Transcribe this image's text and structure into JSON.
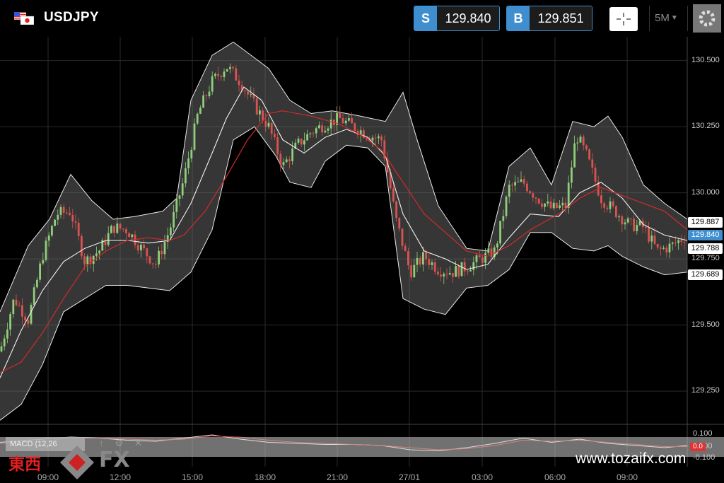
{
  "header": {
    "symbol": "USDJPY",
    "flag_icon": "us-jp-flag-icon",
    "sell": {
      "label": "S",
      "price": "129.840"
    },
    "buy": {
      "label": "B",
      "price": "129.851"
    },
    "crosshair_icon": "crosshair-icon",
    "interval": "5M",
    "settings_icon": "gear-icon"
  },
  "chart_data": {
    "type": "candlestick",
    "symbol": "USDJPY",
    "interval": "5M",
    "ylim": [
      129.13,
      130.59
    ],
    "y_ticks": [
      "130.500",
      "130.250",
      "130.000",
      "129.750",
      "129.500",
      "129.250"
    ],
    "x_ticks": [
      "09:00",
      "12:00",
      "15:00",
      "18:00",
      "21:00",
      "27/01",
      "03:00",
      "06:00",
      "09:00"
    ],
    "indicators": [
      "Bollinger Bands",
      "Moving Average",
      "MACD (12,26)"
    ],
    "price_labels": [
      {
        "value": "129.887",
        "style": "white"
      },
      {
        "value": "129.840",
        "style": "blue"
      },
      {
        "value": "129.788",
        "style": "white"
      },
      {
        "value": "129.689",
        "style": "white"
      }
    ],
    "ma_path": [
      [
        0,
        129.32
      ],
      [
        30,
        129.36
      ],
      [
        60,
        129.47
      ],
      [
        90,
        129.6
      ],
      [
        120,
        129.72
      ],
      [
        150,
        129.78
      ],
      [
        180,
        129.82
      ],
      [
        210,
        129.83
      ],
      [
        240,
        129.82
      ],
      [
        260,
        129.84
      ],
      [
        290,
        129.93
      ],
      [
        320,
        130.06
      ],
      [
        350,
        130.2
      ],
      [
        380,
        130.3
      ],
      [
        400,
        130.31
      ],
      [
        440,
        130.29
      ],
      [
        480,
        130.26
      ],
      [
        510,
        130.22
      ],
      [
        540,
        130.16
      ],
      [
        570,
        130.04
      ],
      [
        600,
        129.92
      ],
      [
        630,
        129.85
      ],
      [
        660,
        129.78
      ],
      [
        690,
        129.76
      ],
      [
        720,
        129.8
      ],
      [
        750,
        129.86
      ],
      [
        790,
        129.92
      ],
      [
        820,
        129.98
      ],
      [
        850,
        130.02
      ],
      [
        880,
        129.99
      ],
      [
        910,
        129.96
      ],
      [
        940,
        129.93
      ],
      [
        972,
        129.86
      ]
    ],
    "mid_band": [
      [
        0,
        129.3
      ],
      [
        30,
        129.48
      ],
      [
        60,
        129.63
      ],
      [
        90,
        129.74
      ],
      [
        120,
        129.79
      ],
      [
        150,
        129.82
      ],
      [
        180,
        129.82
      ],
      [
        210,
        129.81
      ],
      [
        240,
        129.82
      ],
      [
        270,
        129.96
      ],
      [
        300,
        130.15
      ],
      [
        320,
        130.28
      ],
      [
        345,
        130.4
      ],
      [
        370,
        130.35
      ],
      [
        400,
        130.2
      ],
      [
        430,
        130.15
      ],
      [
        460,
        130.21
      ],
      [
        490,
        130.24
      ],
      [
        520,
        130.21
      ],
      [
        545,
        130.14
      ],
      [
        570,
        129.92
      ],
      [
        600,
        129.78
      ],
      [
        630,
        129.75
      ],
      [
        660,
        129.71
      ],
      [
        690,
        129.73
      ],
      [
        720,
        129.83
      ],
      [
        750,
        129.92
      ],
      [
        790,
        129.91
      ],
      [
        820,
        130.0
      ],
      [
        850,
        130.04
      ],
      [
        880,
        129.98
      ],
      [
        910,
        129.88
      ],
      [
        940,
        129.84
      ],
      [
        972,
        129.82
      ]
    ],
    "upper_band": [
      [
        0,
        129.55
      ],
      [
        40,
        129.8
      ],
      [
        70,
        129.9
      ],
      [
        100,
        130.07
      ],
      [
        130,
        129.97
      ],
      [
        160,
        129.9
      ],
      [
        190,
        129.91
      ],
      [
        230,
        129.93
      ],
      [
        250,
        129.98
      ],
      [
        270,
        130.35
      ],
      [
        300,
        130.52
      ],
      [
        330,
        130.57
      ],
      [
        360,
        130.51
      ],
      [
        380,
        130.47
      ],
      [
        410,
        130.35
      ],
      [
        440,
        130.3
      ],
      [
        470,
        130.31
      ],
      [
        510,
        130.29
      ],
      [
        545,
        130.27
      ],
      [
        570,
        130.38
      ],
      [
        590,
        130.2
      ],
      [
        620,
        129.95
      ],
      [
        660,
        129.79
      ],
      [
        690,
        129.78
      ],
      [
        720,
        130.1
      ],
      [
        750,
        130.17
      ],
      [
        780,
        130.03
      ],
      [
        810,
        130.27
      ],
      [
        840,
        130.25
      ],
      [
        860,
        130.29
      ],
      [
        880,
        130.21
      ],
      [
        910,
        130.03
      ],
      [
        940,
        129.96
      ],
      [
        972,
        129.9
      ]
    ],
    "lower_band": [
      [
        0,
        129.14
      ],
      [
        30,
        129.2
      ],
      [
        60,
        129.35
      ],
      [
        90,
        129.55
      ],
      [
        120,
        129.6
      ],
      [
        150,
        129.65
      ],
      [
        180,
        129.65
      ],
      [
        210,
        129.64
      ],
      [
        240,
        129.63
      ],
      [
        270,
        129.7
      ],
      [
        300,
        129.86
      ],
      [
        330,
        130.2
      ],
      [
        360,
        130.25
      ],
      [
        390,
        130.14
      ],
      [
        410,
        130.04
      ],
      [
        440,
        130.02
      ],
      [
        460,
        130.12
      ],
      [
        490,
        130.18
      ],
      [
        520,
        130.17
      ],
      [
        545,
        130.1
      ],
      [
        570,
        129.6
      ],
      [
        600,
        129.56
      ],
      [
        630,
        129.54
      ],
      [
        660,
        129.64
      ],
      [
        690,
        129.65
      ],
      [
        720,
        129.71
      ],
      [
        750,
        129.85
      ],
      [
        780,
        129.85
      ],
      [
        810,
        129.79
      ],
      [
        840,
        129.78
      ],
      [
        860,
        129.8
      ],
      [
        880,
        129.76
      ],
      [
        910,
        129.72
      ],
      [
        940,
        129.69
      ],
      [
        972,
        129.7
      ]
    ],
    "price_path": [
      [
        0,
        129.4
      ],
      [
        20,
        129.6
      ],
      [
        40,
        129.52
      ],
      [
        60,
        129.76
      ],
      [
        80,
        129.92
      ],
      [
        100,
        129.93
      ],
      [
        120,
        129.74
      ],
      [
        140,
        129.78
      ],
      [
        160,
        129.87
      ],
      [
        180,
        129.86
      ],
      [
        200,
        129.79
      ],
      [
        220,
        129.73
      ],
      [
        240,
        129.86
      ],
      [
        260,
        130.05
      ],
      [
        280,
        130.3
      ],
      [
        300,
        130.42
      ],
      [
        320,
        130.48
      ],
      [
        340,
        130.42
      ],
      [
        360,
        130.33
      ],
      [
        380,
        130.25
      ],
      [
        400,
        130.1
      ],
      [
        420,
        130.18
      ],
      [
        440,
        130.23
      ],
      [
        460,
        130.26
      ],
      [
        480,
        130.28
      ],
      [
        500,
        130.25
      ],
      [
        520,
        130.22
      ],
      [
        540,
        130.2
      ],
      [
        560,
        129.9
      ],
      [
        580,
        129.7
      ],
      [
        600,
        129.76
      ],
      [
        620,
        129.71
      ],
      [
        640,
        129.7
      ],
      [
        660,
        129.72
      ],
      [
        680,
        129.75
      ],
      [
        700,
        129.78
      ],
      [
        720,
        130.02
      ],
      [
        740,
        130.04
      ],
      [
        760,
        129.98
      ],
      [
        780,
        129.94
      ],
      [
        800,
        129.95
      ],
      [
        815,
        130.22
      ],
      [
        830,
        130.14
      ],
      [
        850,
        129.98
      ],
      [
        870,
        129.93
      ],
      [
        890,
        129.88
      ],
      [
        910,
        129.87
      ],
      [
        930,
        129.78
      ],
      [
        950,
        129.8
      ],
      [
        972,
        129.84
      ]
    ],
    "macd_line": [
      [
        0,
        0.03
      ],
      [
        60,
        0.06
      ],
      [
        100,
        0.08
      ],
      [
        140,
        0.07
      ],
      [
        180,
        0.05
      ],
      [
        220,
        0.04
      ],
      [
        260,
        0.07
      ],
      [
        300,
        0.1
      ],
      [
        340,
        0.06
      ],
      [
        380,
        0.03
      ],
      [
        420,
        0.02
      ],
      [
        460,
        0.01
      ],
      [
        500,
        0.01
      ],
      [
        540,
        0.0
      ],
      [
        580,
        -0.04
      ],
      [
        620,
        -0.05
      ],
      [
        660,
        -0.02
      ],
      [
        700,
        0.02
      ],
      [
        740,
        0.07
      ],
      [
        780,
        0.03
      ],
      [
        820,
        0.06
      ],
      [
        860,
        0.02
      ],
      [
        900,
        0.0
      ],
      [
        940,
        -0.02
      ],
      [
        972,
        0.0
      ]
    ],
    "macd_signal": [
      [
        0,
        0.02
      ],
      [
        60,
        0.04
      ],
      [
        100,
        0.07
      ],
      [
        140,
        0.07
      ],
      [
        180,
        0.06
      ],
      [
        220,
        0.05
      ],
      [
        260,
        0.06
      ],
      [
        300,
        0.09
      ],
      [
        340,
        0.08
      ],
      [
        380,
        0.05
      ],
      [
        420,
        0.03
      ],
      [
        460,
        0.02
      ],
      [
        500,
        0.01
      ],
      [
        540,
        0.0
      ],
      [
        580,
        -0.02
      ],
      [
        620,
        -0.04
      ],
      [
        660,
        -0.03
      ],
      [
        700,
        0.0
      ],
      [
        740,
        0.05
      ],
      [
        780,
        0.04
      ],
      [
        820,
        0.05
      ],
      [
        860,
        0.03
      ],
      [
        900,
        0.01
      ],
      [
        940,
        -0.01
      ],
      [
        972,
        -0.01
      ]
    ]
  },
  "macd": {
    "label": "MACD (12,26",
    "y_top": "0.100",
    "y_mid": "0.000",
    "y_bot": "-0.100",
    "current": "0.0",
    "ylim": [
      -0.12,
      0.12
    ],
    "gear_icon": "gear-icon",
    "close_icon": "close-icon",
    "arrow_icon": "arrow-up-icon"
  },
  "watermark": {
    "cn_text": "東西",
    "fx_text": "FX",
    "website": "www.tozaifx.com"
  }
}
